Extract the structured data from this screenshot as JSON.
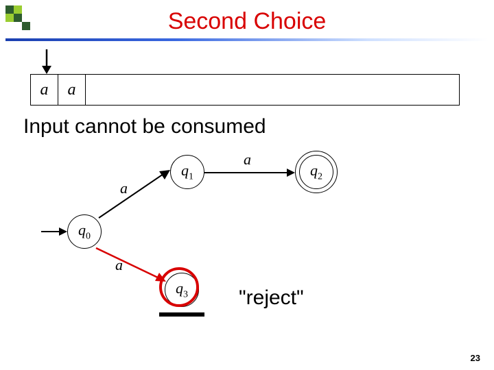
{
  "title": "Second Choice",
  "tape": {
    "cells": [
      "a",
      "a"
    ]
  },
  "subtitle": "Input cannot be consumed",
  "states": {
    "q0": "q0",
    "q1": "q1",
    "q2": "q2",
    "q3": "q3"
  },
  "edges": {
    "q0_q1": "a",
    "q1_q2": "a",
    "q0_q3": "a"
  },
  "reject_label": "\"reject\"",
  "page_number": "23"
}
